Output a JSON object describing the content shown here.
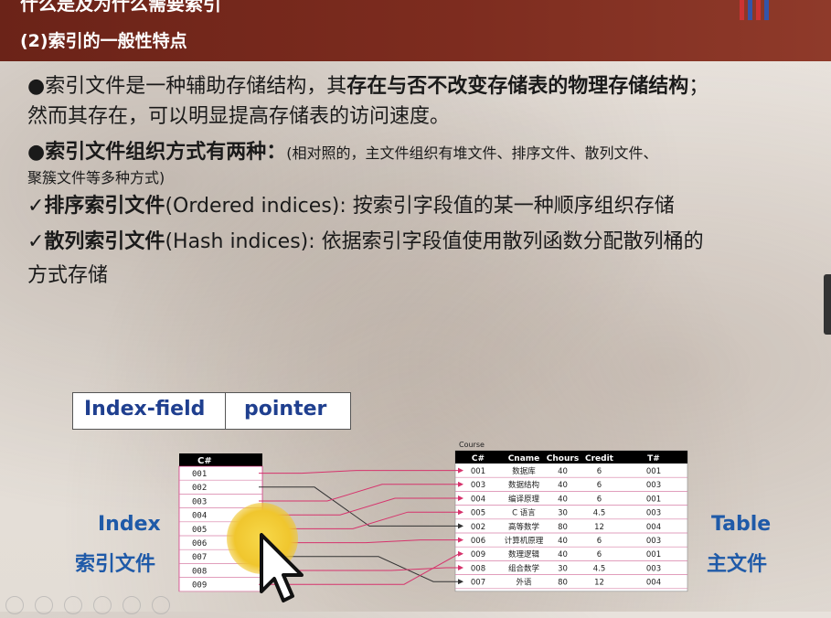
{
  "header": {
    "title_top": "什么是及为什么需要索引",
    "title": "(2)索引的一般性特点"
  },
  "bullets": {
    "b1_a": "●索引文件是一种辅助存储结构，其",
    "b1_bold": "存在与否不改变存储表的物理存储结构",
    "b1_b": "；",
    "b1_line2": "然而其存在，可以明显提高存储表的访问速度。",
    "b2_bold": "●索引文件组织方式有两种：",
    "b2_small": "(相对照的，主文件组织有堆文件、排序文件、散列文件、",
    "b2_small2": "聚簇文件等多种方式)",
    "b3_bold": "✓排序索引文件",
    "b3_rest": "(Ordered indices): 按索引字段值的某一种顺序组织存储",
    "b4_bold": "✓散列索引文件",
    "b4_rest": "(Hash indices):  依据索引字段值使用散列函数分配散列桶的",
    "b4_line2": "方式存储"
  },
  "legend": {
    "field": "Index-field",
    "pointer": "pointer"
  },
  "labels": {
    "index_en": "Index",
    "index_cn": "索引文件",
    "table_en": "Table",
    "table_cn": "主文件"
  },
  "index_table": {
    "header": "C#",
    "rows": [
      "001",
      "002",
      "003",
      "004",
      "005",
      "006",
      "007",
      "008",
      "009"
    ]
  },
  "course_table": {
    "caption": "Course",
    "headers": [
      "C#",
      "Cname",
      "Chours",
      "Credit",
      "T#"
    ],
    "rows": [
      [
        "001",
        "数据库",
        "40",
        "6",
        "001"
      ],
      [
        "003",
        "数据结构",
        "40",
        "6",
        "003"
      ],
      [
        "004",
        "编译原理",
        "40",
        "6",
        "001"
      ],
      [
        "005",
        "C 语言",
        "30",
        "4.5",
        "003"
      ],
      [
        "002",
        "高等数学",
        "80",
        "12",
        "004"
      ],
      [
        "006",
        "计算机原理",
        "40",
        "6",
        "003"
      ],
      [
        "009",
        "数理逻辑",
        "40",
        "6",
        "001"
      ],
      [
        "008",
        "组合数学",
        "30",
        "4.5",
        "003"
      ],
      [
        "007",
        "外语",
        "80",
        "12",
        "004"
      ]
    ]
  },
  "colors": {
    "header_bg": "#7d2c1f",
    "legend_text": "#1f3f8f",
    "side_label": "#1f5aa8",
    "arrow_pink": "#d6336c",
    "arrow_dark": "#333333",
    "table_header": "#000000"
  }
}
